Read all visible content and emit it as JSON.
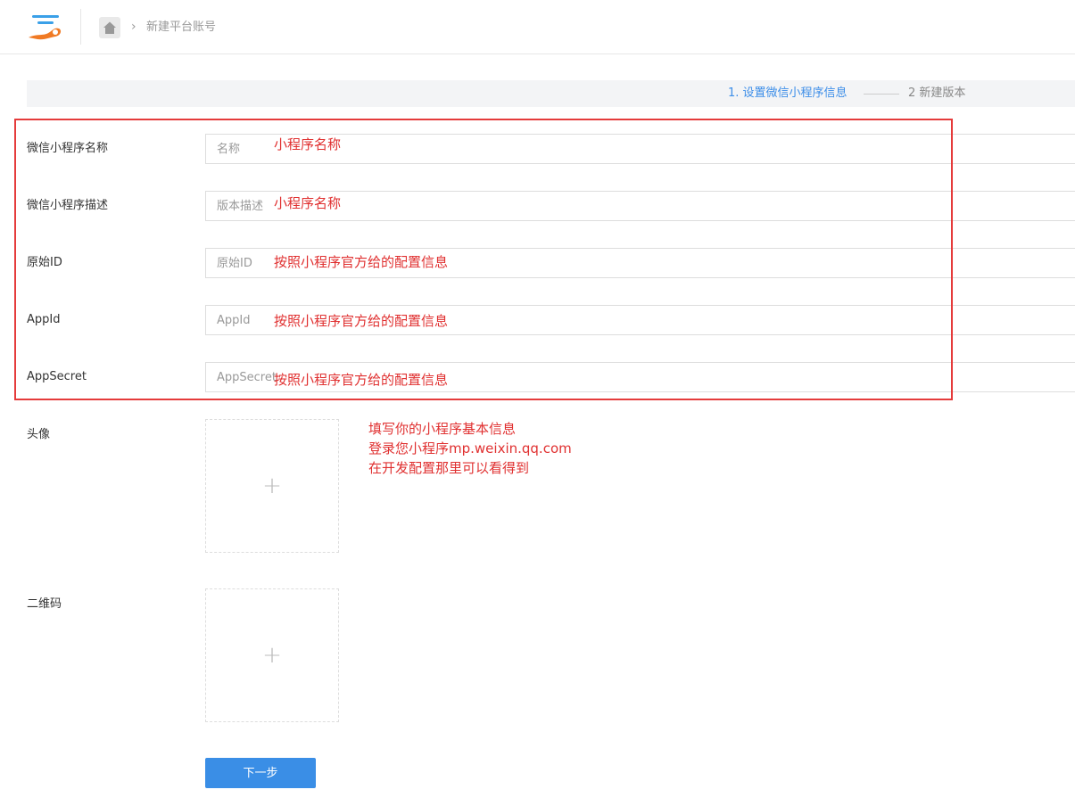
{
  "header": {
    "breadcrumb_current": "新建平台账号",
    "breadcrumb_sep": "›"
  },
  "steps": {
    "step1": "1. 设置微信小程序信息",
    "step2": "2 新建版本"
  },
  "form": {
    "fields": [
      {
        "label": "微信小程序名称",
        "placeholder": "名称",
        "note": "小程序名称"
      },
      {
        "label": "微信小程序描述",
        "placeholder": "版本描述",
        "note": "小程序名称"
      },
      {
        "label": "原始ID",
        "placeholder": "原始ID",
        "note": "按照小程序官方给的配置信息"
      },
      {
        "label": "AppId",
        "placeholder": "AppId",
        "note": "按照小程序官方给的配置信息"
      },
      {
        "label": "AppSecret",
        "placeholder": "AppSecret",
        "note": "按照小程序官方给的配置信息"
      }
    ],
    "avatar_label": "头像",
    "qrcode_label": "二维码",
    "upload_plus": "+",
    "next_label": "下一步"
  },
  "tip_lines": [
    "填写你的小程序基本信息",
    "登录您小程序mp.weixin.qq.com",
    "在开发配置那里可以看得到"
  ],
  "colors": {
    "accent": "#3a8ee6",
    "annotation": "#e53b3b"
  }
}
